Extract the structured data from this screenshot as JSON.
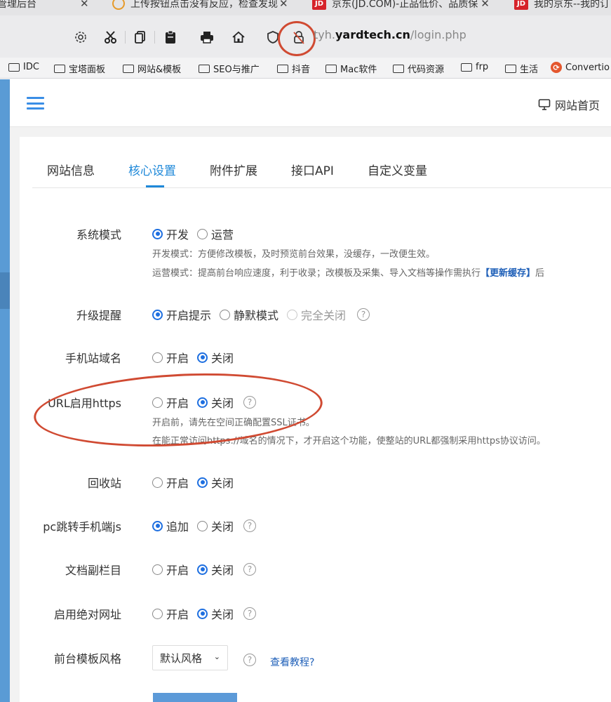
{
  "browser": {
    "tabs": [
      {
        "title": "管理后台",
        "close": "✕"
      },
      {
        "title": "上传按钮点击没有反应，检查发现",
        "close": "✕",
        "icon": "ring-icon"
      },
      {
        "title": "京东(JD.COM)-正品低价、品质保",
        "close": "✕",
        "icon": "jd-icon"
      },
      {
        "title": "我的京东--我的订",
        "icon": "jd-icon"
      }
    ],
    "jd_icon_text": "JD",
    "url_host_prefix": "tyh.",
    "url_host_domain": "yardtech.cn",
    "url_path": "/login.php",
    "bookmarks": [
      "IDC",
      "宝塔面板",
      "网站&模板",
      "SEO与推广",
      "抖音",
      "Mac软件",
      "代码资源",
      "frp",
      "生活",
      "Convertio"
    ],
    "colors": {
      "annotation": "#d04a32"
    }
  },
  "header": {
    "home_link": "网站首页"
  },
  "tabs": [
    {
      "label": "网站信息",
      "active": false
    },
    {
      "label": "核心设置",
      "active": true
    },
    {
      "label": "附件扩展",
      "active": false
    },
    {
      "label": "接口API",
      "active": false
    },
    {
      "label": "自定义变量",
      "active": false
    }
  ],
  "settings": {
    "system_mode": {
      "label": "系统模式",
      "options": [
        "开发",
        "运营"
      ],
      "selected": "开发",
      "hint1": "开发模式：方便修改模板，及时预览前台效果，没缓存，一改便生效。",
      "hint2_pre": "运营模式：提高前台响应速度，利于收录；改模板及采集、导入文档等操作需执行",
      "hint2_link": "【更新缓存】",
      "hint2_post": "后"
    },
    "upgrade_notice": {
      "label": "升级提醒",
      "options": [
        "开启提示",
        "静默模式",
        "完全关闭"
      ],
      "selected": "开启提示",
      "help": "?"
    },
    "mobile_domain": {
      "label": "手机站域名",
      "options": [
        "开启",
        "关闭"
      ],
      "selected": "关闭"
    },
    "https": {
      "label": "URL启用https",
      "options": [
        "开启",
        "关闭"
      ],
      "selected": "关闭",
      "help": "?",
      "hint1": "开启前，请先在空间正确配置SSL证书。",
      "hint2": "在能正常访问https://域名的情况下，才开启这个功能，使整站的URL都强制采用https协议访问。"
    },
    "recycle_bin": {
      "label": "回收站",
      "options": [
        "开启",
        "关闭"
      ],
      "selected": "关闭"
    },
    "pc_redirect": {
      "label": "pc跳转手机端js",
      "options": [
        "追加",
        "关闭"
      ],
      "selected": "追加",
      "help": "?"
    },
    "sub_column": {
      "label": "文档副栏目",
      "options": [
        "开启",
        "关闭"
      ],
      "selected": "关闭",
      "help": "?"
    },
    "absolute_url": {
      "label": "启用绝对网址",
      "options": [
        "开启",
        "关闭"
      ],
      "selected": "关闭",
      "help": "?"
    },
    "template_style": {
      "label": "前台模板风格",
      "value": "默认风格",
      "help": "?",
      "tutorial_link": "查看教程?"
    }
  }
}
